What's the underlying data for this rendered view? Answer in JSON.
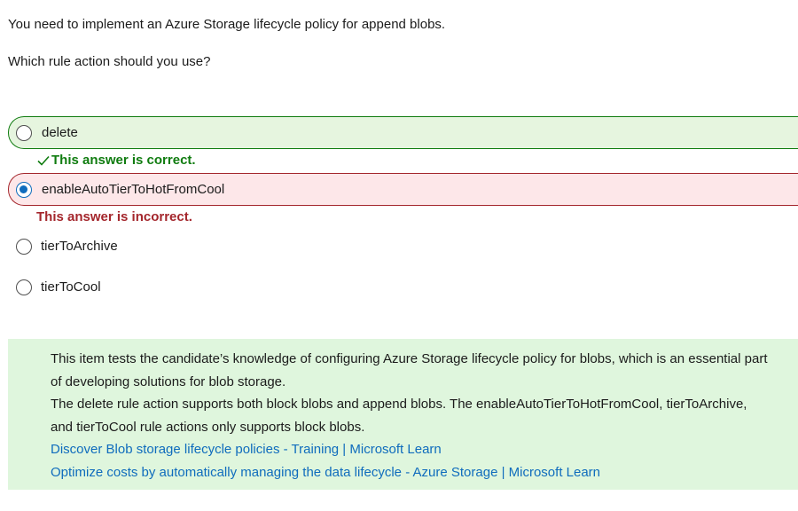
{
  "question": {
    "line1": "You need to implement an Azure Storage lifecycle policy for append blobs.",
    "line2": "Which rule action should you use?"
  },
  "options": [
    {
      "label": "delete",
      "state": "correct",
      "selected": false
    },
    {
      "label": "enableAutoTierToHotFromCool",
      "state": "incorrect",
      "selected": true
    },
    {
      "label": "tierToArchive",
      "state": "neutral",
      "selected": false
    },
    {
      "label": "tierToCool",
      "state": "neutral",
      "selected": false
    }
  ],
  "feedback": {
    "correct": "This answer is correct.",
    "incorrect": "This answer is incorrect."
  },
  "explanation": {
    "paragraph1": "This item tests the candidate’s knowledge of configuring Azure Storage lifecycle policy for blobs, which is an essential part of developing solutions for blob storage.",
    "paragraph2": "The delete rule action supports both block blobs and append blobs. The enableAutoTierToHotFromCool, tierToArchive, and tierToCool rule actions only supports block blobs.",
    "links": [
      "Discover Blob storage lifecycle policies - Training | Microsoft Learn",
      "Optimize costs by automatically managing the data lifecycle - Azure Storage | Microsoft Learn"
    ]
  },
  "colors": {
    "correct_bg": "#e6f5df",
    "correct_border": "#107c10",
    "incorrect_bg": "#fde7e9",
    "incorrect_border": "#a4262c",
    "link": "#0f6cbd",
    "explanation_bg": "#dff6dd"
  },
  "icons": {
    "correct_feedback": "check-icon",
    "radio": "radio-button"
  }
}
